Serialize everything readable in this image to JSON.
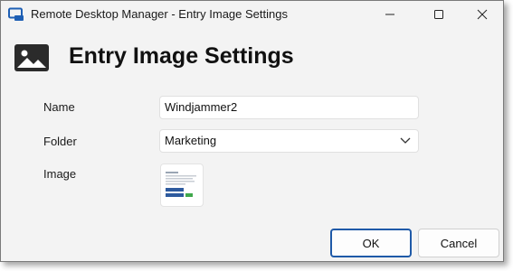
{
  "window": {
    "title": "Remote Desktop Manager - Entry Image Settings"
  },
  "header": {
    "title": "Entry Image Settings",
    "icon": "image-icon"
  },
  "form": {
    "name_label": "Name",
    "name_value": "Windjammer2",
    "folder_label": "Folder",
    "folder_value": "Marketing",
    "image_label": "Image"
  },
  "buttons": {
    "ok": "OK",
    "cancel": "Cancel"
  },
  "colors": {
    "accent": "#1f5aa8",
    "app_icon": "#1e5fb4"
  }
}
